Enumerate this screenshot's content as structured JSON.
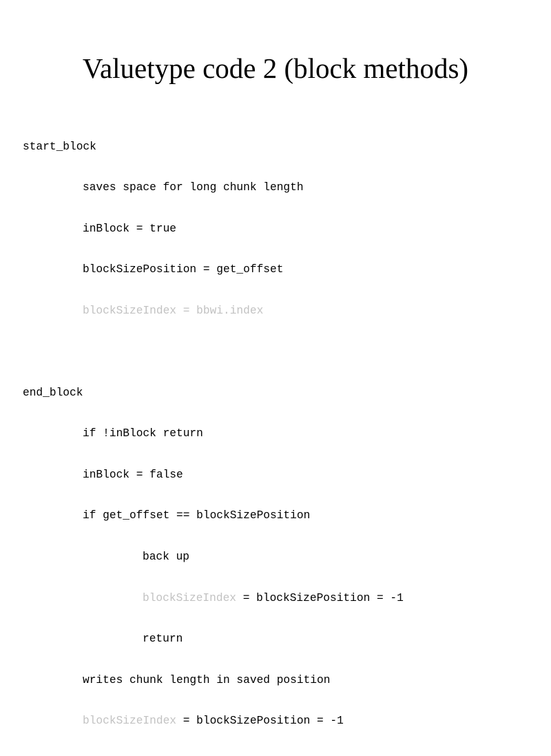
{
  "slide": {
    "title": "Valuetype code 2 (block methods)",
    "dim_color": "#c2c2c2",
    "code": {
      "start_block": "start_block",
      "sb_l1": "saves space for long chunk length",
      "sb_l2": "inBlock = true",
      "sb_l3": "blockSizePosition = get_offset",
      "sb_l4": "blockSizeIndex = bbwi.index",
      "end_block": "end_block",
      "eb_l1": "if !inBlock return",
      "eb_l2": "inBlock = false",
      "eb_l3": "if get_offset == blockSizePosition",
      "eb_l4": "back up",
      "eb_l5_dim": "blockSizeIndex",
      "eb_l5_rest": " = blockSizePosition = -1",
      "eb_l6": "return",
      "eb_l7": "writes chunk length in saved position",
      "eb_l8_dim": "blockSizeIndex",
      "eb_l8_rest": " = blockSizePosition = -1"
    }
  }
}
